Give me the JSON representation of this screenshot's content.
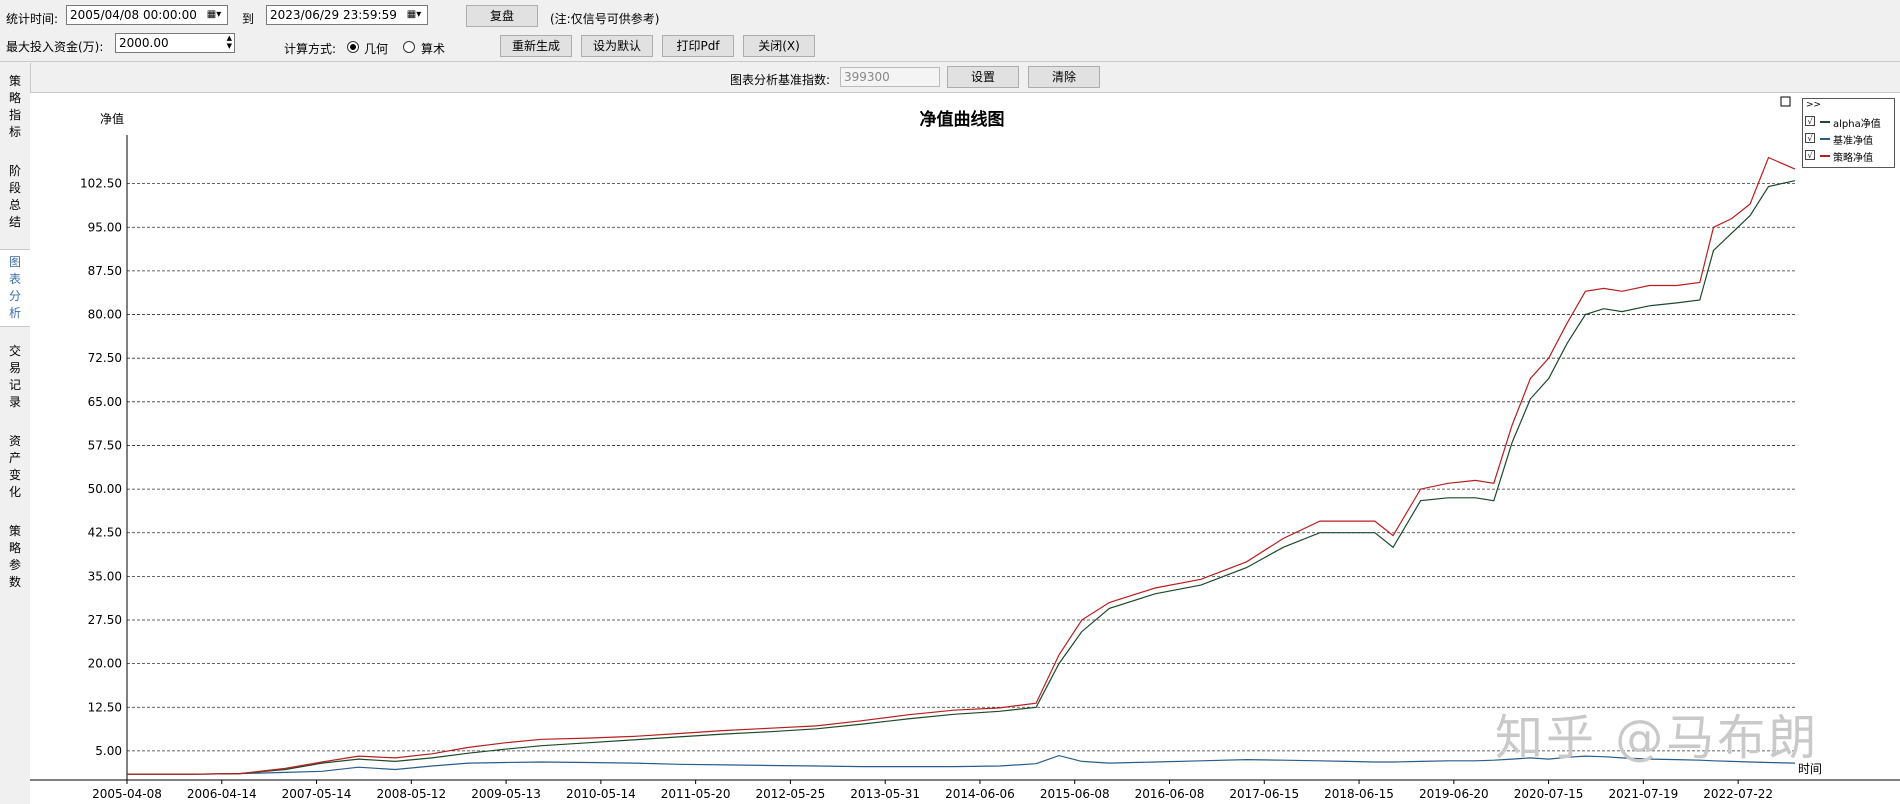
{
  "toolbar": {
    "time_label": "统计时间:",
    "start_time": "2005/04/08 00:00:00",
    "to_label": "到",
    "end_time": "2023/06/29 23:59:59",
    "replay_button": "复盘",
    "note": "(注:仅信号可供参考)",
    "max_fund_label": "最大投入资金(万):",
    "max_fund_value": "2000.00",
    "calc_label": "计算方式:",
    "calc_geo": "几何",
    "calc_arith": "算术",
    "regen_button": "重新生成",
    "default_button": "设为默认",
    "pdf_button": "打印Pdf",
    "close_button": "关闭(X)",
    "benchmark_label": "图表分析基准指数:",
    "benchmark_value": "399300",
    "set_button": "设置",
    "clear_button": "清除"
  },
  "sidebar": {
    "items": [
      {
        "label": "策略指标"
      },
      {
        "label": "阶段总结"
      },
      {
        "label": "图表分析",
        "active": true
      },
      {
        "label": "交易记录"
      },
      {
        "label": "资产变化"
      },
      {
        "label": "策略参数"
      }
    ]
  },
  "legend": {
    "header": ">>",
    "check": "√"
  },
  "watermark": "知乎 @马布朗",
  "colors": {
    "alpha": "#1c4a2a",
    "bench": "#2a5c8a",
    "strategy": "#b81e1e",
    "grid": "#333333"
  },
  "chart_data": {
    "type": "line",
    "title": "净值曲线图",
    "ylabel": "净值",
    "xlabel": "时间",
    "ylim": [
      0,
      110
    ],
    "yticks": [
      "5.00",
      "12.50",
      "20.00",
      "27.50",
      "35.00",
      "42.50",
      "50.00",
      "57.50",
      "65.00",
      "72.50",
      "80.00",
      "87.50",
      "95.00",
      "102.50"
    ],
    "ytick_values": [
      5,
      12.5,
      20,
      27.5,
      35,
      42.5,
      50,
      57.5,
      65,
      72.5,
      80,
      87.5,
      95,
      102.5
    ],
    "categories": [
      "2005-04-08",
      "2006-04-14",
      "2007-05-14",
      "2008-05-12",
      "2009-05-13",
      "2010-05-14",
      "2011-05-20",
      "2012-05-25",
      "2013-05-31",
      "2014-06-06",
      "2015-06-08",
      "2016-06-08",
      "2017-06-15",
      "2018-06-15",
      "2019-06-20",
      "2020-07-15",
      "2021-07-19",
      "2022-07-22"
    ],
    "legend_position": "top-right",
    "grid": "horizontal-dashed",
    "x": [
      2005.27,
      2006.0,
      2006.5,
      2007.0,
      2007.4,
      2007.8,
      2008.2,
      2008.6,
      2009.0,
      2009.4,
      2009.8,
      2010.3,
      2010.8,
      2011.3,
      2011.8,
      2012.3,
      2012.8,
      2013.3,
      2013.8,
      2014.3,
      2014.8,
      2015.2,
      2015.45,
      2015.7,
      2016.0,
      2016.5,
      2017.0,
      2017.5,
      2017.9,
      2018.3,
      2018.6,
      2018.9,
      2019.1,
      2019.4,
      2019.7,
      2020.0,
      2020.2,
      2020.4,
      2020.6,
      2020.8,
      2021.0,
      2021.2,
      2021.4,
      2021.6,
      2021.9,
      2022.2,
      2022.45,
      2022.6,
      2022.8,
      2023.0,
      2023.2,
      2023.49
    ],
    "series": [
      {
        "name": "alpha净值",
        "color": "#1c4a2a",
        "values": [
          1,
          1,
          1.1,
          1.8,
          2.9,
          3.6,
          3.2,
          3.8,
          4.6,
          5.3,
          5.9,
          6.4,
          6.9,
          7.4,
          7.9,
          8.3,
          8.8,
          9.6,
          10.5,
          11.3,
          11.8,
          12.5,
          20,
          25.5,
          29.5,
          32,
          33.5,
          36.5,
          40,
          42.5,
          42.5,
          42.5,
          40,
          48,
          48.5,
          48.5,
          48,
          58,
          65.5,
          69,
          75,
          80,
          81,
          80.5,
          81.5,
          82,
          82.5,
          91,
          94,
          97,
          102,
          103
        ]
      },
      {
        "name": "基准净值",
        "color": "#2a5c8a",
        "values": [
          1,
          1,
          1.1,
          1.3,
          1.5,
          2.2,
          1.8,
          2.4,
          2.9,
          3.0,
          3.1,
          3.0,
          2.9,
          2.7,
          2.6,
          2.5,
          2.4,
          2.3,
          2.3,
          2.3,
          2.4,
          2.8,
          4.2,
          3.2,
          2.9,
          3.1,
          3.3,
          3.5,
          3.4,
          3.3,
          3.2,
          3.1,
          3.1,
          3.2,
          3.3,
          3.3,
          3.4,
          3.6,
          3.8,
          3.6,
          3.9,
          4.1,
          4.0,
          3.8,
          3.6,
          3.5,
          3.4,
          3.3,
          3.2,
          3.1,
          3.0,
          2.9
        ]
      },
      {
        "name": "策略净值",
        "color": "#b81e1e",
        "values": [
          1,
          1,
          1.1,
          2.0,
          3.1,
          4.1,
          3.8,
          4.5,
          5.6,
          6.4,
          7.0,
          7.2,
          7.5,
          8.0,
          8.5,
          8.9,
          9.3,
          10.2,
          11.2,
          12.0,
          12.4,
          13.2,
          21.5,
          27.5,
          30.5,
          33,
          34.5,
          37.5,
          41.5,
          44.5,
          44.5,
          44.5,
          42,
          50,
          51,
          51.5,
          51,
          61,
          69,
          72.5,
          78.5,
          84,
          84.5,
          84,
          85,
          85,
          85.5,
          95,
          96.5,
          99,
          107,
          105
        ]
      }
    ]
  }
}
